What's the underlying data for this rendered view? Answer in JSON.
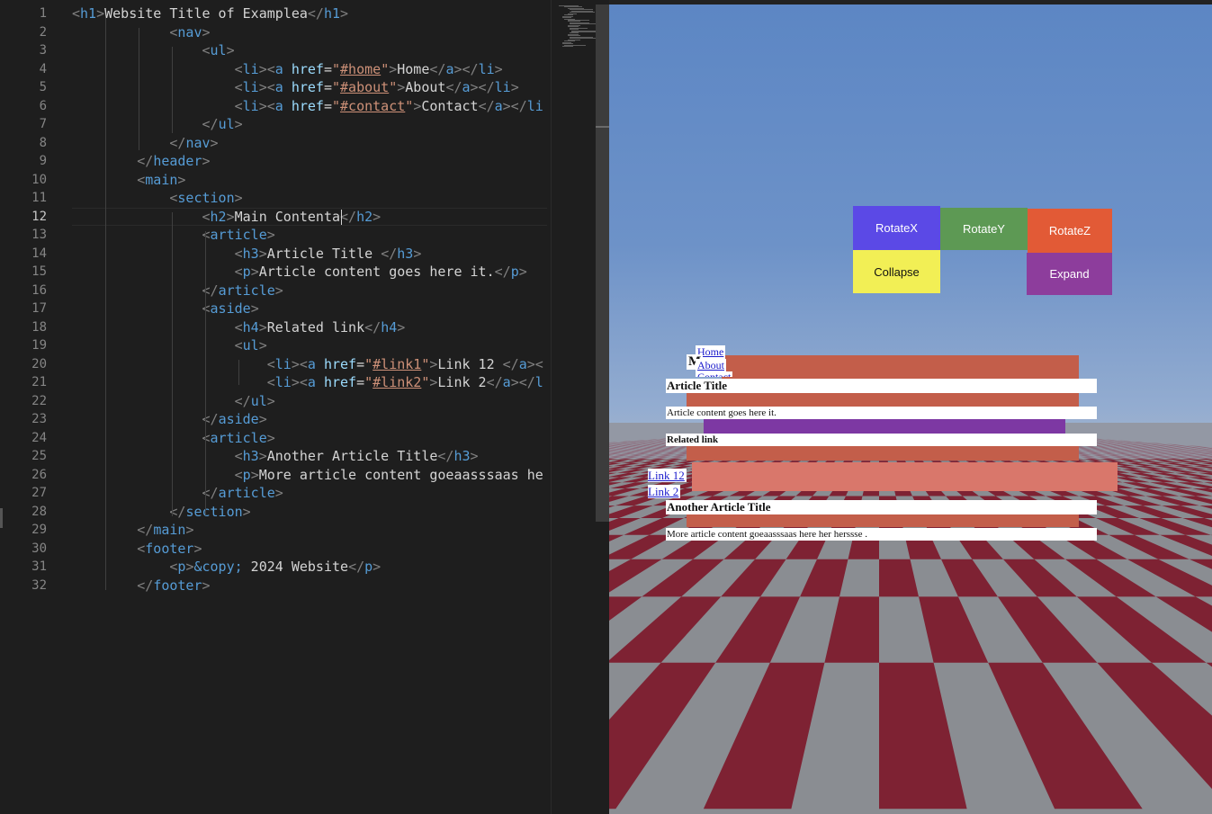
{
  "editor": {
    "line_numbers": [
      "1",
      "2",
      "3",
      "4",
      "5",
      "6",
      "7",
      "8",
      "9",
      "10",
      "11",
      "12",
      "13",
      "14",
      "15",
      "16",
      "17",
      "18",
      "19",
      "20",
      "21",
      "22",
      "23",
      "24",
      "25",
      "26",
      "27",
      "28",
      "29",
      "30",
      "31",
      "32"
    ],
    "active_line": "12",
    "lines": [
      [
        [
          "br",
          "<"
        ],
        [
          "tag",
          "h1"
        ],
        [
          "br",
          ">"
        ],
        [
          "txt",
          "Website Title of Examplea"
        ],
        [
          "br",
          "</"
        ],
        [
          "tag",
          "h1"
        ],
        [
          "br",
          ">"
        ]
      ],
      [
        [
          "txt",
          "            "
        ],
        [
          "br",
          "<"
        ],
        [
          "tag",
          "nav"
        ],
        [
          "br",
          ">"
        ]
      ],
      [
        [
          "txt",
          "                "
        ],
        [
          "br",
          "<"
        ],
        [
          "tag",
          "ul"
        ],
        [
          "br",
          ">"
        ]
      ],
      [
        [
          "txt",
          "                    "
        ],
        [
          "br",
          "<"
        ],
        [
          "tag",
          "li"
        ],
        [
          "br",
          "><"
        ],
        [
          "tag",
          "a"
        ],
        [
          "txt",
          " "
        ],
        [
          "attr",
          "href"
        ],
        [
          "txt",
          "="
        ],
        [
          "val",
          "\""
        ],
        [
          "link",
          "#home"
        ],
        [
          "val",
          "\""
        ],
        [
          "br",
          ">"
        ],
        [
          "txt",
          "Home"
        ],
        [
          "br",
          "</"
        ],
        [
          "tag",
          "a"
        ],
        [
          "br",
          "></"
        ],
        [
          "tag",
          "li"
        ],
        [
          "br",
          ">"
        ]
      ],
      [
        [
          "txt",
          "                    "
        ],
        [
          "br",
          "<"
        ],
        [
          "tag",
          "li"
        ],
        [
          "br",
          "><"
        ],
        [
          "tag",
          "a"
        ],
        [
          "txt",
          " "
        ],
        [
          "attr",
          "href"
        ],
        [
          "txt",
          "="
        ],
        [
          "val",
          "\""
        ],
        [
          "link",
          "#about"
        ],
        [
          "val",
          "\""
        ],
        [
          "br",
          ">"
        ],
        [
          "txt",
          "About"
        ],
        [
          "br",
          "</"
        ],
        [
          "tag",
          "a"
        ],
        [
          "br",
          "></"
        ],
        [
          "tag",
          "li"
        ],
        [
          "br",
          ">"
        ]
      ],
      [
        [
          "txt",
          "                    "
        ],
        [
          "br",
          "<"
        ],
        [
          "tag",
          "li"
        ],
        [
          "br",
          "><"
        ],
        [
          "tag",
          "a"
        ],
        [
          "txt",
          " "
        ],
        [
          "attr",
          "href"
        ],
        [
          "txt",
          "="
        ],
        [
          "val",
          "\""
        ],
        [
          "link",
          "#contact"
        ],
        [
          "val",
          "\""
        ],
        [
          "br",
          ">"
        ],
        [
          "txt",
          "Contact"
        ],
        [
          "br",
          "</"
        ],
        [
          "tag",
          "a"
        ],
        [
          "br",
          "></"
        ],
        [
          "tag",
          "li"
        ]
      ],
      [
        [
          "txt",
          "                "
        ],
        [
          "br",
          "</"
        ],
        [
          "tag",
          "ul"
        ],
        [
          "br",
          ">"
        ]
      ],
      [
        [
          "txt",
          "            "
        ],
        [
          "br",
          "</"
        ],
        [
          "tag",
          "nav"
        ],
        [
          "br",
          ">"
        ]
      ],
      [
        [
          "txt",
          "        "
        ],
        [
          "br",
          "</"
        ],
        [
          "tag",
          "header"
        ],
        [
          "br",
          ">"
        ]
      ],
      [
        [
          "txt",
          "        "
        ],
        [
          "br",
          "<"
        ],
        [
          "tag",
          "main"
        ],
        [
          "br",
          ">"
        ]
      ],
      [
        [
          "txt",
          "            "
        ],
        [
          "br",
          "<"
        ],
        [
          "tag",
          "section"
        ],
        [
          "br",
          ">"
        ]
      ],
      [
        [
          "txt",
          "                "
        ],
        [
          "br",
          "<"
        ],
        [
          "tag",
          "h2"
        ],
        [
          "br",
          ">"
        ],
        [
          "txt",
          "Main Contenta"
        ],
        [
          "br",
          "</"
        ],
        [
          "tag",
          "h2"
        ],
        [
          "br",
          ">"
        ]
      ],
      [
        [
          "txt",
          "                "
        ],
        [
          "br",
          "<"
        ],
        [
          "tag",
          "article"
        ],
        [
          "br",
          ">"
        ]
      ],
      [
        [
          "txt",
          "                    "
        ],
        [
          "br",
          "<"
        ],
        [
          "tag",
          "h3"
        ],
        [
          "br",
          ">"
        ],
        [
          "txt",
          "Article Title "
        ],
        [
          "br",
          "</"
        ],
        [
          "tag",
          "h3"
        ],
        [
          "br",
          ">"
        ]
      ],
      [
        [
          "txt",
          "                    "
        ],
        [
          "br",
          "<"
        ],
        [
          "tag",
          "p"
        ],
        [
          "br",
          ">"
        ],
        [
          "txt",
          "Article content goes here it."
        ],
        [
          "br",
          "</"
        ],
        [
          "tag",
          "p"
        ],
        [
          "br",
          ">"
        ]
      ],
      [
        [
          "txt",
          "                "
        ],
        [
          "br",
          "</"
        ],
        [
          "tag",
          "article"
        ],
        [
          "br",
          ">"
        ]
      ],
      [
        [
          "txt",
          "                "
        ],
        [
          "br",
          "<"
        ],
        [
          "tag",
          "aside"
        ],
        [
          "br",
          ">"
        ]
      ],
      [
        [
          "txt",
          "                    "
        ],
        [
          "br",
          "<"
        ],
        [
          "tag",
          "h4"
        ],
        [
          "br",
          ">"
        ],
        [
          "txt",
          "Related link"
        ],
        [
          "br",
          "</"
        ],
        [
          "tag",
          "h4"
        ],
        [
          "br",
          ">"
        ]
      ],
      [
        [
          "txt",
          "                    "
        ],
        [
          "br",
          "<"
        ],
        [
          "tag",
          "ul"
        ],
        [
          "br",
          ">"
        ]
      ],
      [
        [
          "txt",
          "                        "
        ],
        [
          "br",
          "<"
        ],
        [
          "tag",
          "li"
        ],
        [
          "br",
          "><"
        ],
        [
          "tag",
          "a"
        ],
        [
          "txt",
          " "
        ],
        [
          "attr",
          "href"
        ],
        [
          "txt",
          "="
        ],
        [
          "val",
          "\""
        ],
        [
          "link",
          "#link1"
        ],
        [
          "val",
          "\""
        ],
        [
          "br",
          ">"
        ],
        [
          "txt",
          "Link 12 "
        ],
        [
          "br",
          "</"
        ],
        [
          "tag",
          "a"
        ],
        [
          "br",
          "><"
        ]
      ],
      [
        [
          "txt",
          "                        "
        ],
        [
          "br",
          "<"
        ],
        [
          "tag",
          "li"
        ],
        [
          "br",
          "><"
        ],
        [
          "tag",
          "a"
        ],
        [
          "txt",
          " "
        ],
        [
          "attr",
          "href"
        ],
        [
          "txt",
          "="
        ],
        [
          "val",
          "\""
        ],
        [
          "link",
          "#link2"
        ],
        [
          "val",
          "\""
        ],
        [
          "br",
          ">"
        ],
        [
          "txt",
          "Link 2"
        ],
        [
          "br",
          "</"
        ],
        [
          "tag",
          "a"
        ],
        [
          "br",
          "></"
        ],
        [
          "tag",
          "l"
        ]
      ],
      [
        [
          "txt",
          "                    "
        ],
        [
          "br",
          "</"
        ],
        [
          "tag",
          "ul"
        ],
        [
          "br",
          ">"
        ]
      ],
      [
        [
          "txt",
          "                "
        ],
        [
          "br",
          "</"
        ],
        [
          "tag",
          "aside"
        ],
        [
          "br",
          ">"
        ]
      ],
      [
        [
          "txt",
          "                "
        ],
        [
          "br",
          "<"
        ],
        [
          "tag",
          "article"
        ],
        [
          "br",
          ">"
        ]
      ],
      [
        [
          "txt",
          "                    "
        ],
        [
          "br",
          "<"
        ],
        [
          "tag",
          "h3"
        ],
        [
          "br",
          ">"
        ],
        [
          "txt",
          "Another Article Title"
        ],
        [
          "br",
          "</"
        ],
        [
          "tag",
          "h3"
        ],
        [
          "br",
          ">"
        ]
      ],
      [
        [
          "txt",
          "                    "
        ],
        [
          "br",
          "<"
        ],
        [
          "tag",
          "p"
        ],
        [
          "br",
          ">"
        ],
        [
          "txt",
          "More article content goeaasssaas he"
        ]
      ],
      [
        [
          "txt",
          "                "
        ],
        [
          "br",
          "</"
        ],
        [
          "tag",
          "article"
        ],
        [
          "br",
          ">"
        ]
      ],
      [
        [
          "txt",
          "            "
        ],
        [
          "br",
          "</"
        ],
        [
          "tag",
          "section"
        ],
        [
          "br",
          ">"
        ]
      ],
      [
        [
          "txt",
          "        "
        ],
        [
          "br",
          "</"
        ],
        [
          "tag",
          "main"
        ],
        [
          "br",
          ">"
        ]
      ],
      [
        [
          "txt",
          "        "
        ],
        [
          "br",
          "<"
        ],
        [
          "tag",
          "footer"
        ],
        [
          "br",
          ">"
        ]
      ],
      [
        [
          "txt",
          "            "
        ],
        [
          "br",
          "<"
        ],
        [
          "tag",
          "p"
        ],
        [
          "br",
          ">"
        ],
        [
          "ent",
          "&copy;"
        ],
        [
          "txt",
          " 2024 Website"
        ],
        [
          "br",
          "</"
        ],
        [
          "tag",
          "p"
        ],
        [
          "br",
          ">"
        ]
      ],
      [
        [
          "txt",
          "        "
        ],
        [
          "br",
          "</"
        ],
        [
          "tag",
          "footer"
        ],
        [
          "br",
          ">"
        ]
      ]
    ]
  },
  "viewport": {
    "buttons": {
      "rotate_x": "RotateX",
      "rotate_y": "RotateY",
      "rotate_z": "RotateZ",
      "collapse": "Collapse",
      "expand": "Expand"
    },
    "button_colors": {
      "rotate_x": "#5b49e6",
      "rotate_y": "#5d9954",
      "rotate_z": "#e25a36",
      "collapse": "#f2ef55",
      "expand": "#8d3d9c"
    },
    "sky_color": "#5c86c4",
    "floor_colors": [
      "#7e2233",
      "#8d8f92"
    ],
    "layer_colors": [
      "#c35e4a",
      "#7d38a3",
      "#d9776b"
    ],
    "render": {
      "nav_links": [
        "Home",
        "About",
        "Contact"
      ],
      "partial_heading": "M",
      "article_title": "Article Title",
      "article_text": "Article content goes here it.",
      "related_title": "Related link",
      "links": [
        "Link 12",
        "Link 2"
      ],
      "another_title": "Another Article Title",
      "more_text": "More article content goeaasssaas here her herssse ."
    }
  }
}
